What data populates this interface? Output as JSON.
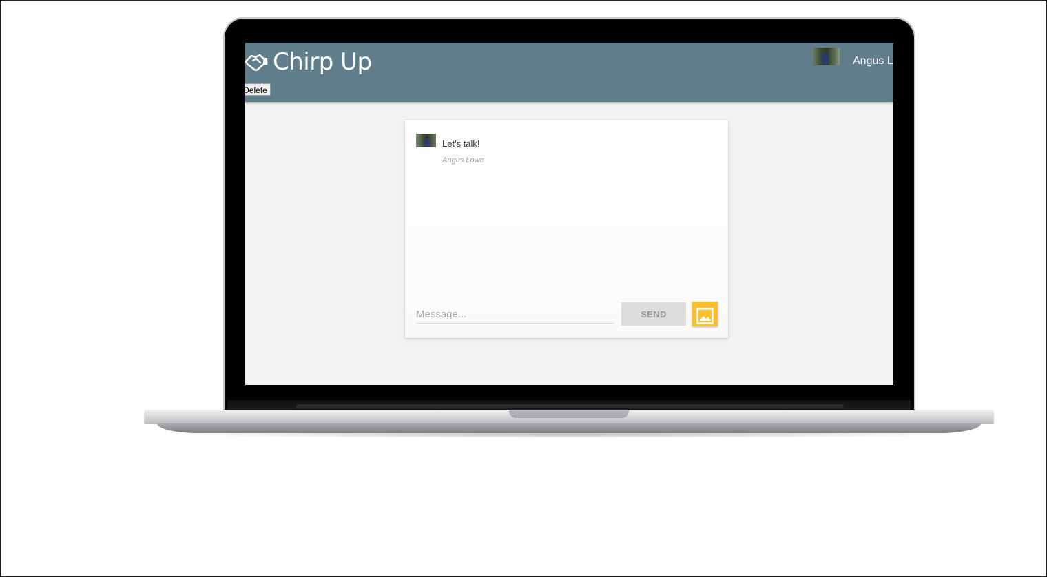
{
  "app": {
    "title": "Chirp Up",
    "logo_icon": "handshake-icon"
  },
  "header": {
    "user_name": "Angus Lowe",
    "delete_label": "Delete"
  },
  "chat": {
    "messages": [
      {
        "text": "Let's talk!",
        "author": "Angus Lowe"
      }
    ],
    "input": {
      "placeholder": "Message...",
      "value": ""
    },
    "send_label": "SEND",
    "image_button_icon": "image-icon"
  },
  "colors": {
    "header_bg": "#607d8b",
    "image_button": "#fbc02d",
    "send_button_bg": "#dcdcdc"
  }
}
